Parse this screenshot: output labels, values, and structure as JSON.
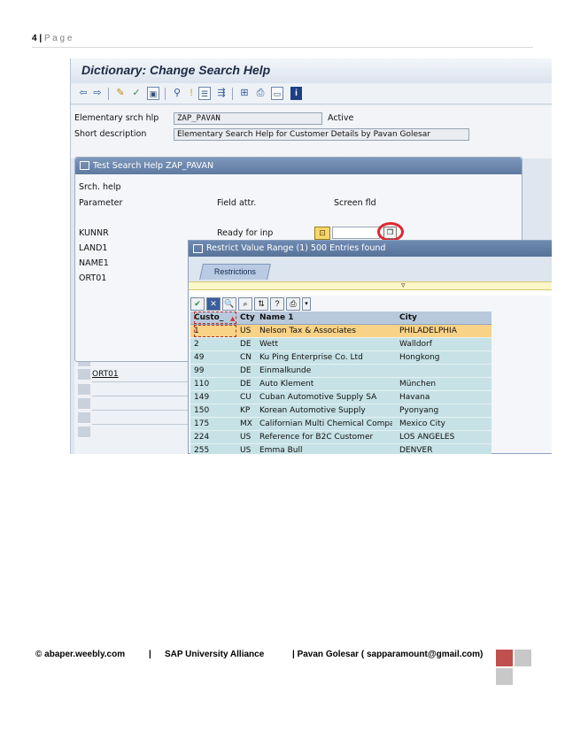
{
  "header": {
    "page_number": "4",
    "sep": "|",
    "page_word": "P a g e"
  },
  "sap": {
    "screen_title": "Dictionary: Change Search Help",
    "form": {
      "label_srch_hlp": "Elementary srch hlp",
      "value_srch_hlp": "ZAP_PAVAN",
      "status": "Active",
      "label_short_desc": "Short description",
      "value_short_desc": "Elementary Search Help for Customer Details by Pavan Golesar"
    },
    "test_dialog": {
      "title": "Test Search Help ZAP_PAVAN",
      "srch_help_label": "Srch. help",
      "parameter_label": "Parameter",
      "field_attr_label": "Field attr.",
      "screen_fld_label": "Screen fld",
      "ready_for_inp": "Ready for inp",
      "params": [
        "KUNNR",
        "LAND1",
        "NAME1",
        "ORT01"
      ]
    },
    "bg_table_cell": "ORT01",
    "restrict_dialog": {
      "title": "Restrict Value Range (1)  500 Entries found",
      "tab_label": "Restrictions",
      "columns": [
        "Custo_",
        "Cty",
        "Name 1",
        "City"
      ],
      "rows": [
        [
          "1",
          "US",
          "Nelson Tax & Associates",
          "PHILADELPHIA"
        ],
        [
          "2",
          "DE",
          "Wett",
          "Walldorf"
        ],
        [
          "49",
          "CN",
          "Ku Ping Enterprise Co. Ltd",
          "Hongkong"
        ],
        [
          "99",
          "DE",
          "Einmalkunde",
          ""
        ],
        [
          "110",
          "DE",
          "Auto Klement",
          "München"
        ],
        [
          "149",
          "CU",
          "Cuban Automotive Supply SA",
          "Havana"
        ],
        [
          "150",
          "KP",
          "Korean Automotive Supply",
          "Pyonyang"
        ],
        [
          "175",
          "MX",
          "Californian Multi Chemical Company",
          "Mexico City"
        ],
        [
          "224",
          "US",
          "Reference for B2C Customer",
          "LOS ANGELES"
        ],
        [
          "255",
          "US",
          "Emma Bull",
          "DENVER"
        ]
      ],
      "selected_row_index": 0
    }
  },
  "footer": {
    "site": "© abaper.weebly.com",
    "sep1": "|",
    "alliance": "SAP University Alliance",
    "author": "| Pavan Golesar ( sapparamount@gmail.com)"
  },
  "colors": {
    "accent_red": "#c0504d",
    "square_gray": "#c8c8c8",
    "selected_row": "#f8d286",
    "grid_row": "#c7e2e6"
  }
}
